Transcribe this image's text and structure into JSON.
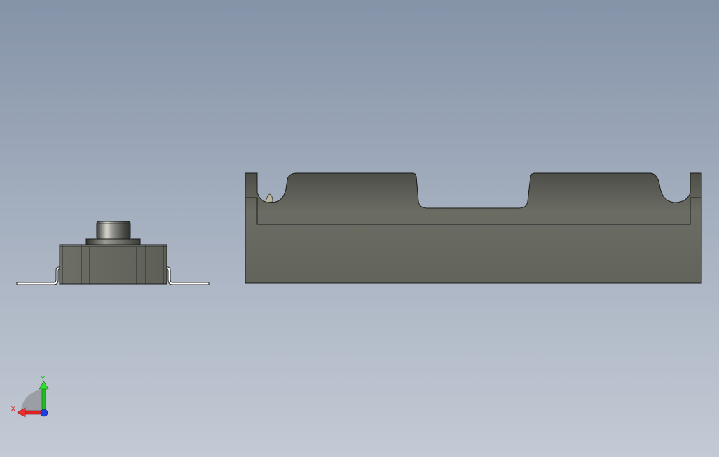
{
  "viewport": {
    "background_top": "#8593a8",
    "background_bottom": "#c4cad5"
  },
  "parts": {
    "side_view": {
      "name": "side-view-part",
      "body_color": "#616259"
    },
    "front_view": {
      "name": "front-view-part",
      "body_color": "#616259"
    }
  },
  "triad": {
    "x_label": "X",
    "y_label": "Y",
    "x_color": "#e02020",
    "y_color": "#20c020",
    "z_color": "#2040e0",
    "x_icon": "x-axis-arrow-icon",
    "y_icon": "y-axis-arrow-icon",
    "z_icon": "z-axis-dot-icon"
  }
}
